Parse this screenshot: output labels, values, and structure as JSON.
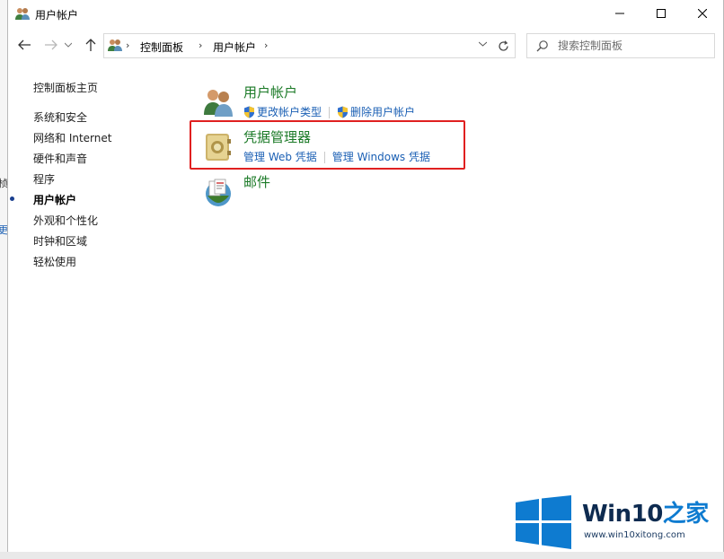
{
  "window": {
    "title": "用户帐户"
  },
  "address": {
    "crumbs": [
      "控制面板",
      "用户帐户"
    ]
  },
  "search": {
    "placeholder": "搜索控制面板",
    "value": ""
  },
  "sidebar": {
    "home": "控制面板主页",
    "items": [
      {
        "label": "系统和安全",
        "current": false
      },
      {
        "label": "网络和 Internet",
        "current": false
      },
      {
        "label": "硬件和声音",
        "current": false
      },
      {
        "label": "程序",
        "current": false
      },
      {
        "label": "用户帐户",
        "current": true
      },
      {
        "label": "外观和个性化",
        "current": false
      },
      {
        "label": "时钟和区域",
        "current": false
      },
      {
        "label": "轻松使用",
        "current": false
      }
    ]
  },
  "categories": [
    {
      "title": "用户帐户",
      "icon": "users-icon",
      "links": [
        "更改帐户类型",
        "删除用户帐户"
      ]
    },
    {
      "title": "凭据管理器",
      "icon": "vault-icon",
      "links": [
        "管理 Web 凭据",
        "管理 Windows 凭据"
      ],
      "highlighted": true
    },
    {
      "title": "邮件",
      "icon": "mail-icon",
      "links": []
    }
  ],
  "watermark": {
    "brand_a": "Win10",
    "brand_b": "之家",
    "url": "www.win10xitong.com"
  },
  "colors": {
    "category_title": "#1b7a27",
    "link": "#1a5fb4",
    "highlight": "#e02020",
    "win_logo": "#0e7bd0"
  }
}
